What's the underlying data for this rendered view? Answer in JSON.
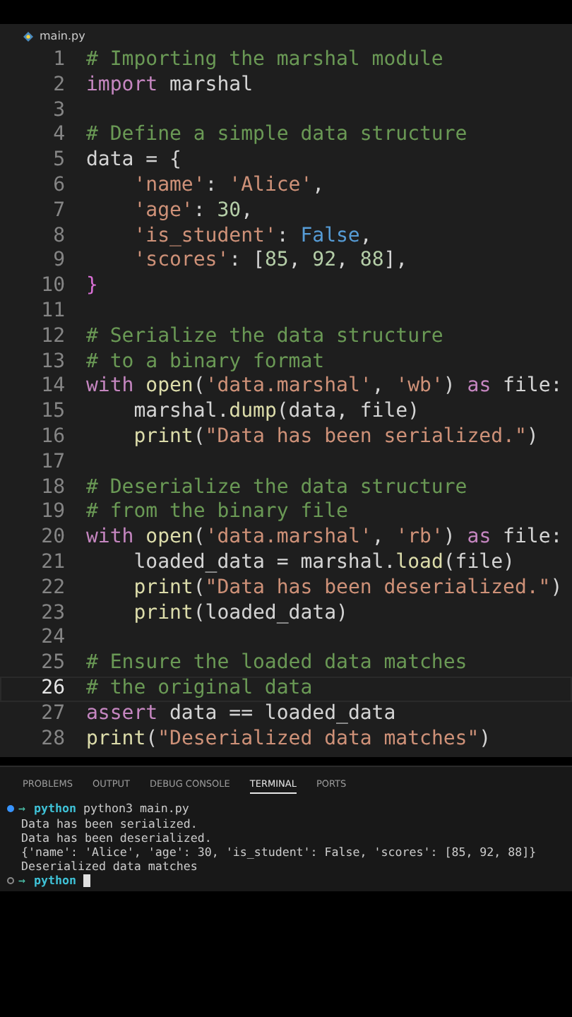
{
  "editor_tab": {
    "title": "main.py"
  },
  "code_lines": [
    {
      "number": "1",
      "current": false,
      "tokens": [
        {
          "kind": "comment",
          "text": "# Importing the marshal module"
        }
      ]
    },
    {
      "number": "2",
      "current": false,
      "tokens": [
        {
          "kind": "keyword",
          "text": "import"
        },
        {
          "kind": "plain",
          "text": " marshal"
        }
      ]
    },
    {
      "number": "3",
      "current": false
    },
    {
      "number": "4",
      "current": false,
      "tokens": [
        {
          "kind": "comment",
          "text": "# Define a simple data structure"
        }
      ]
    },
    {
      "number": "5",
      "current": false,
      "tokens": [
        {
          "kind": "plain",
          "text": "data = {"
        }
      ]
    },
    {
      "number": "6",
      "current": false,
      "tokens": [
        {
          "kind": "string",
          "text": "    'name'"
        },
        {
          "kind": "plain",
          "text": ": "
        },
        {
          "kind": "string",
          "text": "'Alice'"
        },
        {
          "kind": "plain",
          "text": ","
        }
      ]
    },
    {
      "number": "7",
      "current": false,
      "tokens": [
        {
          "kind": "string",
          "text": "    'age'"
        },
        {
          "kind": "plain",
          "text": ": "
        },
        {
          "kind": "number",
          "text": "30"
        },
        {
          "kind": "plain",
          "text": ","
        }
      ]
    },
    {
      "number": "8",
      "current": false,
      "tokens": [
        {
          "kind": "string",
          "text": "    'is_student'"
        },
        {
          "kind": "plain",
          "text": ": "
        },
        {
          "kind": "constant",
          "text": "False"
        },
        {
          "kind": "plain",
          "text": ","
        }
      ]
    },
    {
      "number": "9",
      "current": false,
      "tokens": [
        {
          "kind": "string",
          "text": "    'scores'"
        },
        {
          "kind": "plain",
          "text": ": ["
        },
        {
          "kind": "number",
          "text": "85"
        },
        {
          "kind": "plain",
          "text": ", "
        },
        {
          "kind": "number",
          "text": "92"
        },
        {
          "kind": "plain",
          "text": ", "
        },
        {
          "kind": "number",
          "text": "88"
        },
        {
          "kind": "plain",
          "text": "],"
        }
      ]
    },
    {
      "number": "10",
      "current": false,
      "tokens": [
        {
          "kind": "bracket",
          "text": "}"
        }
      ]
    },
    {
      "number": "11",
      "current": false
    },
    {
      "number": "12",
      "current": false,
      "tokens": [
        {
          "kind": "comment",
          "text": "# Serialize the data structure"
        }
      ]
    },
    {
      "number": "13",
      "current": false,
      "tokens": [
        {
          "kind": "comment",
          "text": "# to a binary format"
        }
      ]
    },
    {
      "number": "14",
      "current": false,
      "tokens": [
        {
          "kind": "keyword",
          "text": "with"
        },
        {
          "kind": "function",
          "text": " open"
        },
        {
          "kind": "plain",
          "text": "("
        },
        {
          "kind": "string",
          "text": "'data.marshal'"
        },
        {
          "kind": "plain",
          "text": ", "
        },
        {
          "kind": "string",
          "text": "'wb'"
        },
        {
          "kind": "plain",
          "text": ") "
        },
        {
          "kind": "keyword",
          "text": "as"
        },
        {
          "kind": "plain",
          "text": " file:"
        }
      ]
    },
    {
      "number": "15",
      "current": false,
      "tokens": [
        {
          "kind": "plain",
          "text": "    marshal."
        },
        {
          "kind": "function",
          "text": "dump"
        },
        {
          "kind": "plain",
          "text": "(data, file)"
        }
      ]
    },
    {
      "number": "16",
      "current": false,
      "tokens": [
        {
          "kind": "function",
          "text": "    print"
        },
        {
          "kind": "plain",
          "text": "("
        },
        {
          "kind": "string",
          "text": "\"Data has been serialized.\""
        },
        {
          "kind": "plain",
          "text": ")"
        }
      ]
    },
    {
      "number": "17",
      "current": false
    },
    {
      "number": "18",
      "current": false,
      "tokens": [
        {
          "kind": "comment",
          "text": "# Deserialize the data structure"
        }
      ]
    },
    {
      "number": "19",
      "current": false,
      "tokens": [
        {
          "kind": "comment",
          "text": "# from the binary file"
        }
      ]
    },
    {
      "number": "20",
      "current": false,
      "tokens": [
        {
          "kind": "keyword",
          "text": "with"
        },
        {
          "kind": "function",
          "text": " open"
        },
        {
          "kind": "plain",
          "text": "("
        },
        {
          "kind": "string",
          "text": "'data.marshal'"
        },
        {
          "kind": "plain",
          "text": ", "
        },
        {
          "kind": "string",
          "text": "'rb'"
        },
        {
          "kind": "plain",
          "text": ") "
        },
        {
          "kind": "keyword",
          "text": "as"
        },
        {
          "kind": "plain",
          "text": " file:"
        }
      ]
    },
    {
      "number": "21",
      "current": false,
      "tokens": [
        {
          "kind": "plain",
          "text": "    loaded_data = marshal."
        },
        {
          "kind": "function",
          "text": "load"
        },
        {
          "kind": "plain",
          "text": "(file)"
        }
      ]
    },
    {
      "number": "22",
      "current": false,
      "tokens": [
        {
          "kind": "function",
          "text": "    print"
        },
        {
          "kind": "plain",
          "text": "("
        },
        {
          "kind": "string",
          "text": "\"Data has been deserialized.\""
        },
        {
          "kind": "plain",
          "text": ")"
        }
      ]
    },
    {
      "number": "23",
      "current": false,
      "tokens": [
        {
          "kind": "function",
          "text": "    print"
        },
        {
          "kind": "plain",
          "text": "(loaded_data)"
        }
      ]
    },
    {
      "number": "24",
      "current": false
    },
    {
      "number": "25",
      "current": false,
      "tokens": [
        {
          "kind": "comment",
          "text": "# Ensure the loaded data matches"
        }
      ]
    },
    {
      "number": "26",
      "current": true,
      "tokens": [
        {
          "kind": "comment",
          "text": "# the original data"
        }
      ]
    },
    {
      "number": "27",
      "current": false,
      "tokens": [
        {
          "kind": "keyword",
          "text": "assert"
        },
        {
          "kind": "plain",
          "text": " data == loaded_data"
        }
      ]
    },
    {
      "number": "28",
      "current": false,
      "tokens": [
        {
          "kind": "function",
          "text": "print"
        },
        {
          "kind": "plain",
          "text": "("
        },
        {
          "kind": "string",
          "text": "\"Deserialized data matches\""
        },
        {
          "kind": "plain",
          "text": ")"
        }
      ]
    }
  ],
  "panel_tabs": [
    {
      "label": "PROBLEMS",
      "selected": false
    },
    {
      "label": "OUTPUT",
      "selected": false
    },
    {
      "label": "DEBUG CONSOLE",
      "selected": false
    },
    {
      "label": "TERMINAL",
      "selected": true
    },
    {
      "label": "PORTS",
      "selected": false
    }
  ],
  "terminal_lines": [
    {
      "kind": "prompt",
      "finished": true,
      "arrow": "→",
      "cwd": "python",
      "command": "python3 main.py",
      "cursor": false
    },
    {
      "kind": "output",
      "text": "Data has been serialized."
    },
    {
      "kind": "output",
      "text": "Data has been deserialized."
    },
    {
      "kind": "output",
      "text": "{'name': 'Alice', 'age': 30, 'is_student': False, 'scores': [85, 92, 88]}"
    },
    {
      "kind": "output",
      "text": "Deserialized data matches"
    },
    {
      "kind": "prompt",
      "finished": false,
      "arrow": "→",
      "cwd": "python",
      "cursor": true
    }
  ]
}
